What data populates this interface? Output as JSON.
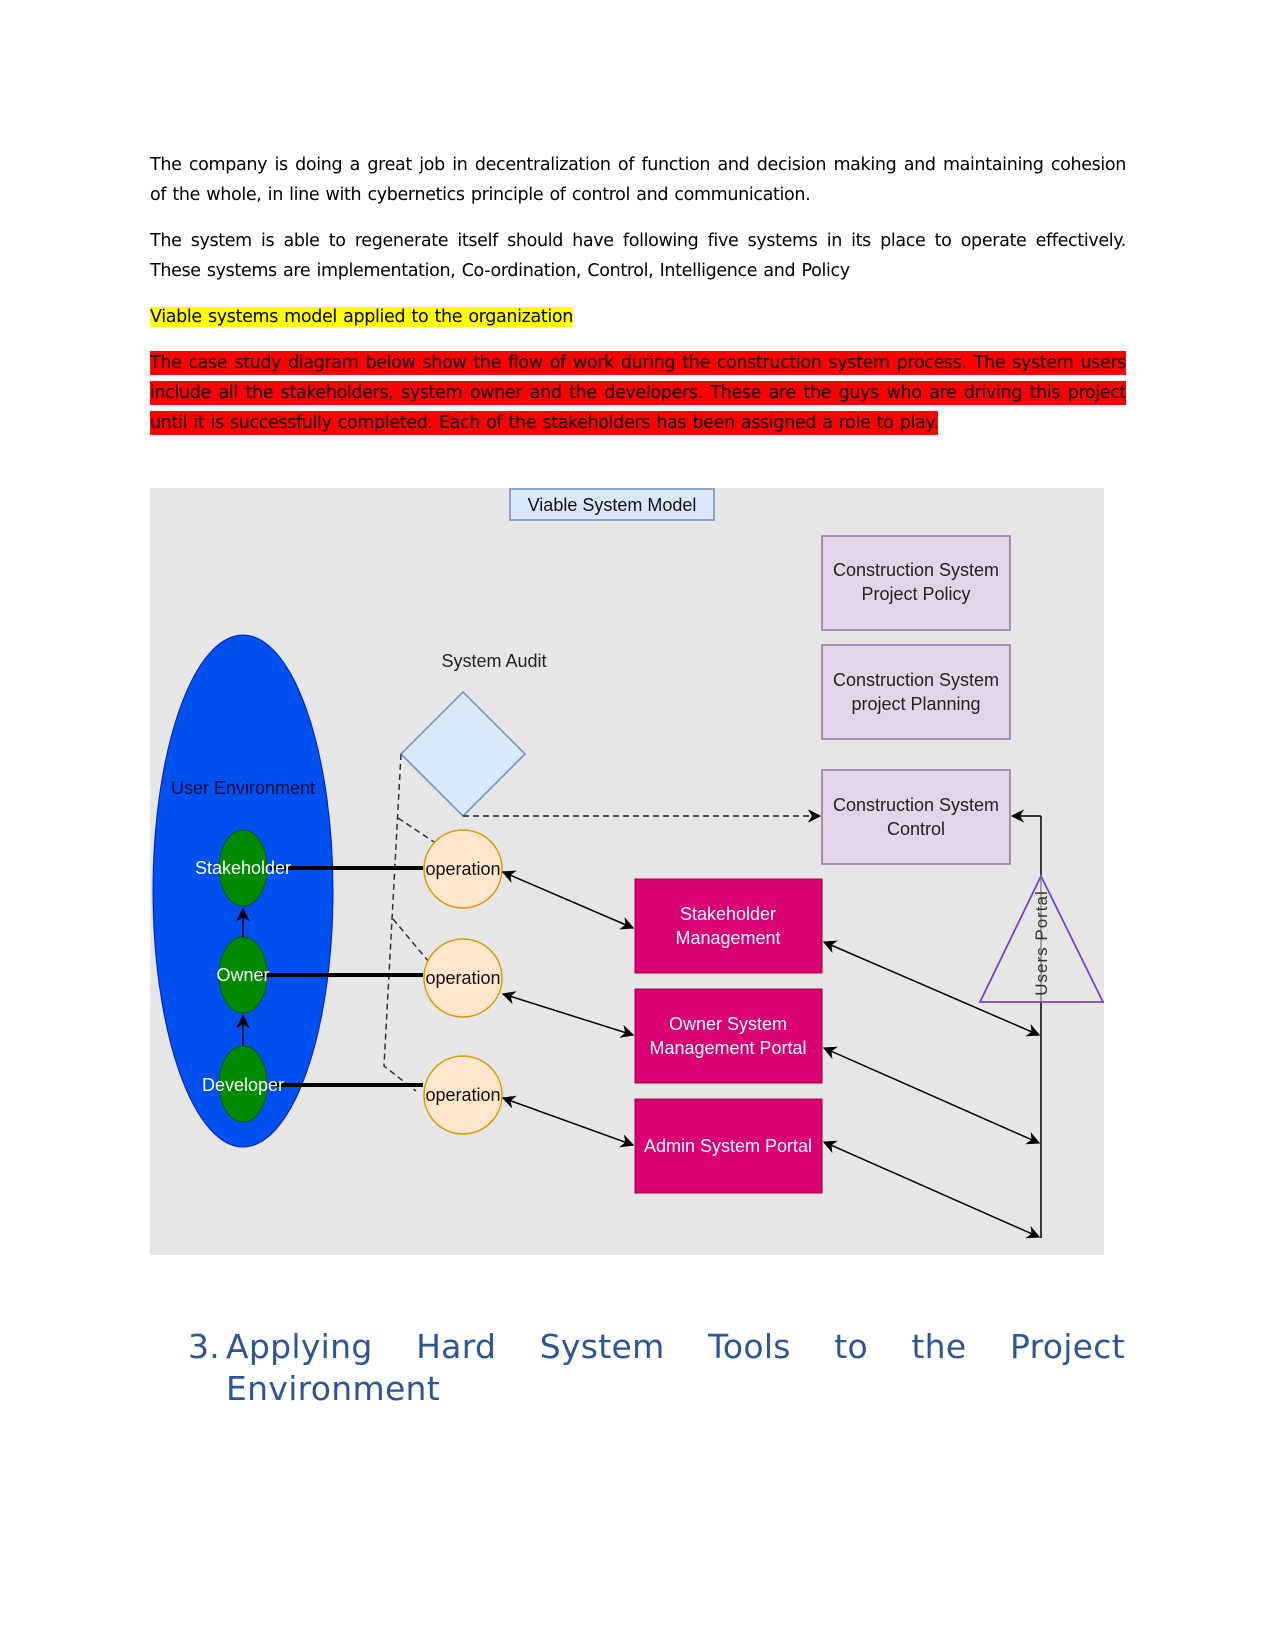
{
  "document": {
    "paragraphs": [
      "The company is doing a great job in decentralization of function and decision making and maintaining cohesion of the whole, in line with cybernetics principle of control and communication.",
      "The system is able to regenerate itself should have following five systems in its place to operate effectively. These systems are implementation, Co-ordination, Control, Intelligence and Policy"
    ],
    "highlighted_caption": "Viable systems model applied to the organization",
    "red_paragraph": "The case study diagram below show the flow of work during the construction system process. The system users include all the stakeholders, system owner and the developers. These are the guys who are driving this project until it is successfully completed. Each of the stakeholders has been assigned a role to play.",
    "heading": {
      "number": "3.",
      "words_line1": [
        "Applying",
        "Hard",
        "System",
        "Tools",
        "to",
        "the",
        "Project"
      ],
      "line2": "Environment"
    },
    "highlight_colors": {
      "yellow": "#ffff00",
      "red": "#ff0000",
      "heading": "#2f5496"
    }
  },
  "diagram": {
    "title": "Viable System Model",
    "user_environment": {
      "label": "User Environment",
      "roles": [
        "Stakeholder",
        "Owner",
        "Developer"
      ]
    },
    "system_audit": "System Audit",
    "operations": [
      "operation",
      "operation",
      "operation"
    ],
    "management_boxes": [
      "Stakeholder Management",
      "Owner System Management Portal",
      "Admin System Portal"
    ],
    "construction_boxes": [
      {
        "line1": "Construction System",
        "line2": "Project Policy"
      },
      {
        "line1": "Construction System",
        "line2": "project  Planning"
      },
      {
        "line1": "Construction System",
        "line2": "Control"
      }
    ],
    "management_lines": [
      [
        "Stakeholder",
        "Management"
      ],
      [
        "Owner System",
        "Management Portal"
      ],
      [
        "Admin System Portal"
      ]
    ],
    "users_portal": "Users Portal",
    "colors": {
      "background": "#e6e6e6",
      "user_env": "#0050ef",
      "role": "#008a00",
      "operation_fill": "#ffe6cc",
      "operation_stroke": "#d79b00",
      "management": "#d80073",
      "construction_fill": "#e1d5e7",
      "construction_stroke": "#9673a6",
      "audit_fill": "#dae8fc",
      "audit_stroke": "#6c8ebf",
      "portal_stroke": "#7e3fd6"
    }
  }
}
